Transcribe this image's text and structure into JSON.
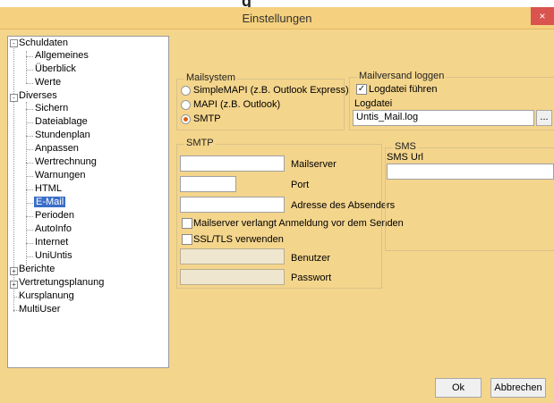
{
  "top_strip_text": "g",
  "window": {
    "title": "Einstellungen",
    "close_glyph": "×"
  },
  "tree": {
    "items": [
      {
        "label": "Schuldaten",
        "expander": "-"
      },
      {
        "label": "Allgemeines"
      },
      {
        "label": "Überblick"
      },
      {
        "label": "Werte"
      },
      {
        "label": "Diverses",
        "expander": "-"
      },
      {
        "label": "Sichern"
      },
      {
        "label": "Dateiablage"
      },
      {
        "label": "Stundenplan"
      },
      {
        "label": "Anpassen"
      },
      {
        "label": "Wertrechnung"
      },
      {
        "label": "Warnungen"
      },
      {
        "label": "HTML"
      },
      {
        "label": "E-Mail",
        "selected": true
      },
      {
        "label": "Perioden"
      },
      {
        "label": "AutoInfo"
      },
      {
        "label": "Internet"
      },
      {
        "label": "UniUntis"
      },
      {
        "label": "Berichte",
        "expander": "+"
      },
      {
        "label": "Vertretungsplanung",
        "expander": "+"
      },
      {
        "label": "Kursplanung"
      },
      {
        "label": "MultiUser"
      }
    ]
  },
  "mailsystem": {
    "legend": "Mailsystem",
    "options": [
      "SimpleMAPI (z.B. Outlook Express)",
      "MAPI (z.B. Outlook)",
      "SMTP"
    ],
    "selected": "SMTP"
  },
  "mailversand": {
    "legend": "Mailversand loggen",
    "checkbox_label": "Logdatei führen",
    "checked": true,
    "check_glyph": "✓",
    "file_label": "Logdatei",
    "file_value": "Untis_Mail.log",
    "browse_label": "..."
  },
  "smtp": {
    "legend": "SMTP",
    "mailserver_label": "Mailserver",
    "mailserver_value": "",
    "port_label": "Port",
    "port_value": "",
    "sender_label": "Adresse des Absenders",
    "sender_value": "",
    "auth_label": "Mailserver verlangt Anmeldung vor dem Senden",
    "ssl_label": "SSL/TLS verwenden",
    "user_label": "Benutzer",
    "password_label": "Passwort"
  },
  "sms": {
    "legend": "SMS",
    "url_label": "SMS Url",
    "url_value": ""
  },
  "buttons": {
    "ok": "Ok",
    "cancel": "Abbrechen"
  },
  "colors": {
    "title_bar": "#f5d07e",
    "client": "#f4d58c",
    "selection": "#3a6ec8",
    "close": "#d9534f"
  }
}
